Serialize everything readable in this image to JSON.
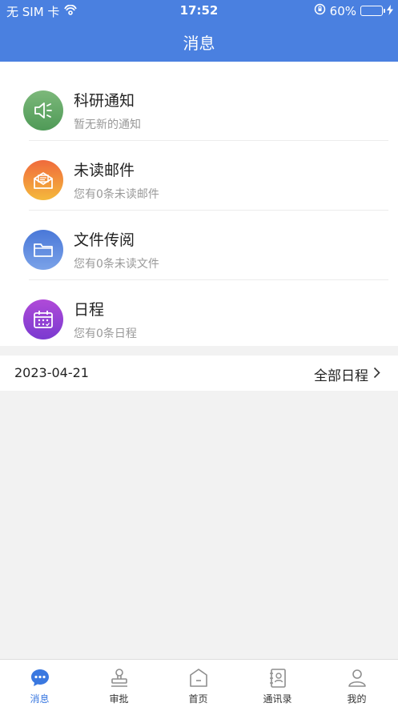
{
  "status_bar": {
    "carrier": "无 SIM 卡",
    "time": "17:52",
    "battery": "60%",
    "battery_level": 0.6,
    "icons": [
      "wifi-icon",
      "orientation-lock-icon",
      "battery-icon",
      "charging-icon"
    ]
  },
  "nav": {
    "title": "消息"
  },
  "messages": [
    {
      "title": "科研通知",
      "subtitle": "暂无新的通知",
      "icon": "speaker-icon",
      "color_top": "#7cb87a",
      "color_bottom": "#4f9a57"
    },
    {
      "title": "未读邮件",
      "subtitle": "您有0条未读邮件",
      "icon": "mail-icon",
      "color_top": "#f06a3c",
      "color_bottom": "#f4b93c"
    },
    {
      "title": "文件传阅",
      "subtitle": "您有0条未读文件",
      "icon": "folder-icon",
      "color_top": "#4a78d8",
      "color_bottom": "#7aa2e8"
    },
    {
      "title": "日程",
      "subtitle": "您有0条日程",
      "icon": "calendar-icon",
      "color_top": "#b04ad8",
      "color_bottom": "#7a3ad0"
    }
  ],
  "schedule": {
    "date": "2023-04-21",
    "all_label": "全部日程"
  },
  "tabs": [
    {
      "label": "消息",
      "icon": "chat-bubble-icon",
      "active": true
    },
    {
      "label": "审批",
      "icon": "stamp-icon",
      "active": false
    },
    {
      "label": "首页",
      "icon": "home-icon",
      "active": false
    },
    {
      "label": "通讯录",
      "icon": "contacts-icon",
      "active": false
    },
    {
      "label": "我的",
      "icon": "person-icon",
      "active": false
    }
  ],
  "colors": {
    "primary": "#4a80e0",
    "active_tab": "#3a78e0",
    "inactive_tab": "#8e8e8e"
  }
}
